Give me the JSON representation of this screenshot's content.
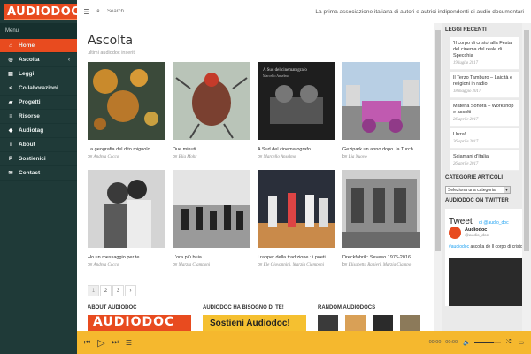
{
  "sidebar": {
    "logo": "AUDIODOC",
    "menu_title": "Menu",
    "items": [
      {
        "label": "Home",
        "icon": "home-icon",
        "glyph": "⌂",
        "active": true
      },
      {
        "label": "Ascolta",
        "icon": "headphones-icon",
        "glyph": "◎",
        "caret": "‹"
      },
      {
        "label": "Leggi",
        "icon": "book-icon",
        "glyph": "▤"
      },
      {
        "label": "Collaborazioni",
        "icon": "share-icon",
        "glyph": "<"
      },
      {
        "label": "Progetti",
        "icon": "folder-icon",
        "glyph": "▰"
      },
      {
        "label": "Risorse",
        "icon": "list-icon",
        "glyph": "≡"
      },
      {
        "label": "Audiotag",
        "icon": "tag-icon",
        "glyph": "◆"
      },
      {
        "label": "About",
        "icon": "info-icon",
        "glyph": "i"
      },
      {
        "label": "Sostienici",
        "icon": "paypal-icon",
        "glyph": "P"
      },
      {
        "label": "Contact",
        "icon": "mail-icon",
        "glyph": "✉"
      }
    ]
  },
  "topbar": {
    "search_placeholder": "Search...",
    "tagline": "La prima associazione italiana di autori e autrici indipendenti di audio documentari"
  },
  "main": {
    "title": "Ascolta",
    "subtitle": "ultimi audiodoc inseriti",
    "by": "by",
    "cards": [
      {
        "title": "La geografia del dito mignolo",
        "author": "Andrea Cocco"
      },
      {
        "title": "Due minuti",
        "author": "Elia Mohr"
      },
      {
        "title": "A Sud del cinematografo",
        "author": "Marcello Anselmo",
        "caption": "A Sud del cinematografo",
        "caption_author": "Marcello Anselmo"
      },
      {
        "title": "Gezipark un anno dopo. la Turch...",
        "author": "Lia Nuovo"
      },
      {
        "title": "Ho un messaggio per te",
        "author": "Andrea Cocco"
      },
      {
        "title": "L'ora più buia",
        "author": "Marzia Ciamponi"
      },
      {
        "title": "I rapper della tradizione : i poeti...",
        "author": "Ele Giovannini, Marzia Ciamponi"
      },
      {
        "title": "Dreckfabrik: Seveso 1976-2016",
        "author": "Elisabetta Ranieri, Marzia Ciampo"
      }
    ],
    "pages": [
      "1",
      "2",
      "3",
      "›"
    ],
    "about_title": "ABOUT AUDIODOC",
    "about_logo": "AUDIODOC",
    "support_title": "AUDIODOC HA BISOGNO DI TE!",
    "support_banner": "Sostieni Audiodoc!",
    "random_title": "RANDOM AUDIODOCS"
  },
  "right": {
    "recent_title": "LEGGI RECENTI",
    "recent": [
      {
        "title": "'Il corpo di cristo' alla Festa del cinema del reale di Specchia",
        "date": "19 luglio 2017"
      },
      {
        "title": "Il Terzo Tamburo – Laicità e religioni in radio",
        "date": "18 maggio 2017"
      },
      {
        "title": "Materia Sonora – Workshop e ascolti",
        "date": "26 aprile 2017"
      },
      {
        "title": "Unza!",
        "date": "26 aprile 2017"
      },
      {
        "title": "Sciamani d'Italia",
        "date": "26 aprile 2017"
      }
    ],
    "categories_title": "CATEGORIE ARTICOLI",
    "categories_select": "Seleziona una categoria",
    "twitter_title": "AUDIODOC ON TWITTER",
    "tweet_head": "Tweet",
    "tweet_handle": "di @audio_doc",
    "tweet_name": "Audiodoc",
    "tweet_user": "@audio_doc",
    "tweet_tag": "#audiodoc",
    "tweet_text": " ascolta de Il corpo di cristo"
  },
  "player": {
    "time": "00:00 · 00:00"
  }
}
